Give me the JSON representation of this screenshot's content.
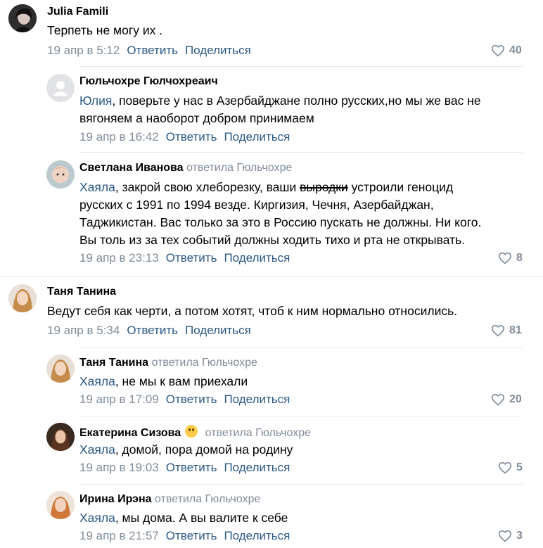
{
  "comments": [
    {
      "author": "Julia Famili",
      "replied_to": "",
      "lines": [
        "Терпеть не могу их ."
      ],
      "date": "19 апр в 5:12",
      "reply_label": "Ответить",
      "share_label": "Поделиться",
      "likes": "40"
    },
    {
      "author": "Гюльчохре Гюлчохреаич",
      "replied_to": "",
      "mention": "Юлия",
      "lines": [
        ", поверьте у нас в Азербайджане полно русских,но мы же вас не",
        "вягоняем а наоборот добром принимаем"
      ],
      "date": "19 апр в 16:42",
      "reply_label": "Ответить",
      "share_label": "Поделиться",
      "likes": ""
    },
    {
      "author": "Светлана Иванова",
      "replied_to": "ответила Гюльчохре",
      "mention": "Хаяла",
      "line1_a": ", закрой свою хлеборезку, ваши ",
      "line1_strike": "выродки",
      "line1_b": " устроили геноцид",
      "lines": [
        "русских с 1991 по 1994 везде. Киргизия, Чечня, Азербайджан,",
        "Таджикистан. Вас только за это в Россию пускать не должны. Ни кого.",
        "Вы толь из за тех событий должны ходить тихо и рта не открывать."
      ],
      "date": "19 апр в 23:13",
      "reply_label": "Ответить",
      "share_label": "Поделиться",
      "likes": "8"
    },
    {
      "author": "Таня Танина",
      "replied_to": "",
      "lines": [
        "Ведут себя как черти, а потом хотят, чтоб к ним нормально относились."
      ],
      "date": "19 апр в 5:34",
      "reply_label": "Ответить",
      "share_label": "Поделиться",
      "likes": "81"
    },
    {
      "author": "Таня Танина",
      "replied_to": "ответила Гюльчохре",
      "mention": "Хаяла",
      "lines": [
        ", не мы к вам приехали"
      ],
      "date": "19 апр в 17:09",
      "reply_label": "Ответить",
      "share_label": "Поделиться",
      "likes": "20"
    },
    {
      "author": "Екатерина Сизова",
      "replied_to": "ответила Гюльчохре",
      "mention": "Хаяла",
      "lines": [
        ", домой, пора домой на родину"
      ],
      "date": "19 апр в 19:03",
      "reply_label": "Ответить",
      "share_label": "Поделиться",
      "likes": "5"
    },
    {
      "author": "Ирина Ирэна",
      "replied_to": "ответила Гюльчохре",
      "mention": "Хаяла",
      "lines": [
        ", мы дома. А вы валите к себе"
      ],
      "date": "19 апр в 21:57",
      "reply_label": "Ответить",
      "share_label": "Поделиться",
      "likes": "3"
    }
  ],
  "icons": {
    "like": "heart-outline-icon",
    "default_avatar": "default-avatar-icon",
    "emoji": "smiling-face-emoji"
  },
  "colors": {
    "link": "#2a5885",
    "meta": "#818c99",
    "separator": "#e7e8ec"
  }
}
